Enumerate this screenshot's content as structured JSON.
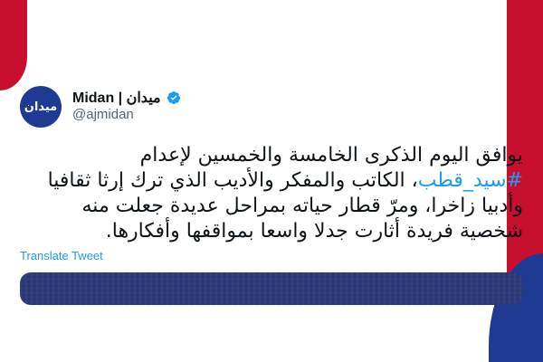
{
  "colors": {
    "accent_red": "#c8102e",
    "accent_navy": "#1f3a93",
    "link_blue": "#1d9bf0",
    "text_dark": "#0f1419",
    "text_muted": "#536471"
  },
  "account": {
    "avatar_text": "ميدان",
    "display_name": "Midan | ميدان",
    "verified_icon": "verified-badge-icon",
    "handle": "@ajmidan"
  },
  "tweet": {
    "line1": "يوافق اليوم الذكرى الخامسة والخمسين لإعدام",
    "hashtag": "#سيد_قطب",
    "line2_rest": "، الكاتب والمفكر والأديب الذي ترك إرثا ثقافيا",
    "line3": "وأدبيا زاخرا، ومرّ قطار حياته بمراحل عديدة جعلت منه",
    "line4": "شخصية فريدة أثارت جدلا واسعا بمواقفها وأفكارها."
  },
  "actions": {
    "translate_label": "Translate Tweet"
  }
}
